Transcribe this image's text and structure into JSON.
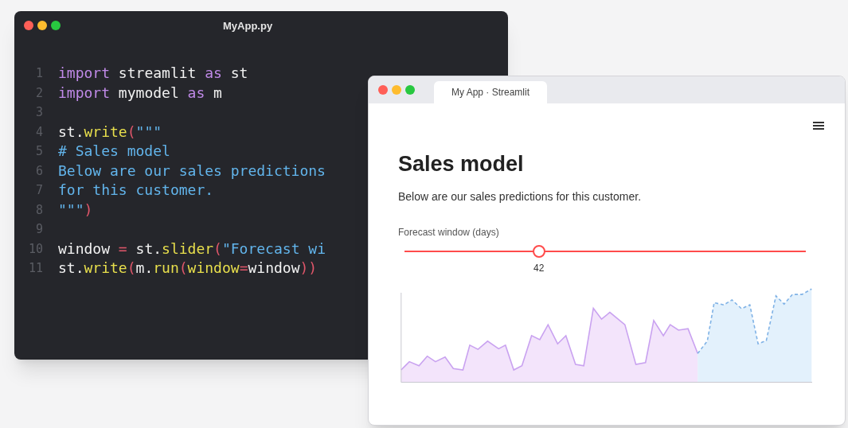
{
  "editor": {
    "title": "MyApp.py",
    "lines": [
      {
        "number": "1",
        "tokens": [
          {
            "text": "import",
            "kind": "keyword"
          },
          {
            "text": " streamlit ",
            "kind": "plain"
          },
          {
            "text": "as",
            "kind": "keyword"
          },
          {
            "text": " st",
            "kind": "plain"
          }
        ]
      },
      {
        "number": "2",
        "tokens": [
          {
            "text": "import",
            "kind": "keyword"
          },
          {
            "text": " mymodel ",
            "kind": "plain"
          },
          {
            "text": "as",
            "kind": "keyword"
          },
          {
            "text": " m",
            "kind": "plain"
          }
        ]
      },
      {
        "number": "3"
      },
      {
        "number": "4",
        "tokens": [
          {
            "text": "st.",
            "kind": "plain"
          },
          {
            "text": "write",
            "kind": "call"
          },
          {
            "text": "(",
            "kind": "punct"
          },
          {
            "text": "\"\"\"",
            "kind": "string"
          }
        ]
      },
      {
        "number": "5",
        "tokens": [
          {
            "text": "# Sales model",
            "kind": "string"
          }
        ]
      },
      {
        "number": "6",
        "tokens": [
          {
            "text": "Below are our sales predictions",
            "kind": "string"
          }
        ]
      },
      {
        "number": "7",
        "tokens": [
          {
            "text": "for this customer.",
            "kind": "string"
          }
        ]
      },
      {
        "number": "8",
        "tokens": [
          {
            "text": "\"\"\"",
            "kind": "string"
          },
          {
            "text": ")",
            "kind": "punct"
          }
        ]
      },
      {
        "number": "9"
      },
      {
        "number": "10",
        "tokens": [
          {
            "text": "window ",
            "kind": "plain"
          },
          {
            "text": "=",
            "kind": "punct"
          },
          {
            "text": " st.",
            "kind": "plain"
          },
          {
            "text": "slider",
            "kind": "call"
          },
          {
            "text": "(",
            "kind": "punct"
          },
          {
            "text": "\"Forecast wi",
            "kind": "string"
          }
        ]
      },
      {
        "number": "11",
        "tokens": [
          {
            "text": "st.",
            "kind": "plain"
          },
          {
            "text": "write",
            "kind": "call"
          },
          {
            "text": "(",
            "kind": "punct"
          },
          {
            "text": "m.",
            "kind": "plain"
          },
          {
            "text": "run",
            "kind": "call"
          },
          {
            "text": "(",
            "kind": "punct"
          },
          {
            "text": "window",
            "kind": "call"
          },
          {
            "text": "=",
            "kind": "punct"
          },
          {
            "text": "window",
            "kind": "plain"
          },
          {
            "text": "))",
            "kind": "punct"
          }
        ]
      }
    ]
  },
  "browser": {
    "tab": {
      "label": "My App · Streamlit",
      "selected": true
    },
    "page": {
      "heading": "Sales model",
      "text": "Below are our sales predictions for this customer.",
      "slider": {
        "label": "Forecast window (days)",
        "level": 0.34,
        "reading": "42"
      }
    }
  }
}
